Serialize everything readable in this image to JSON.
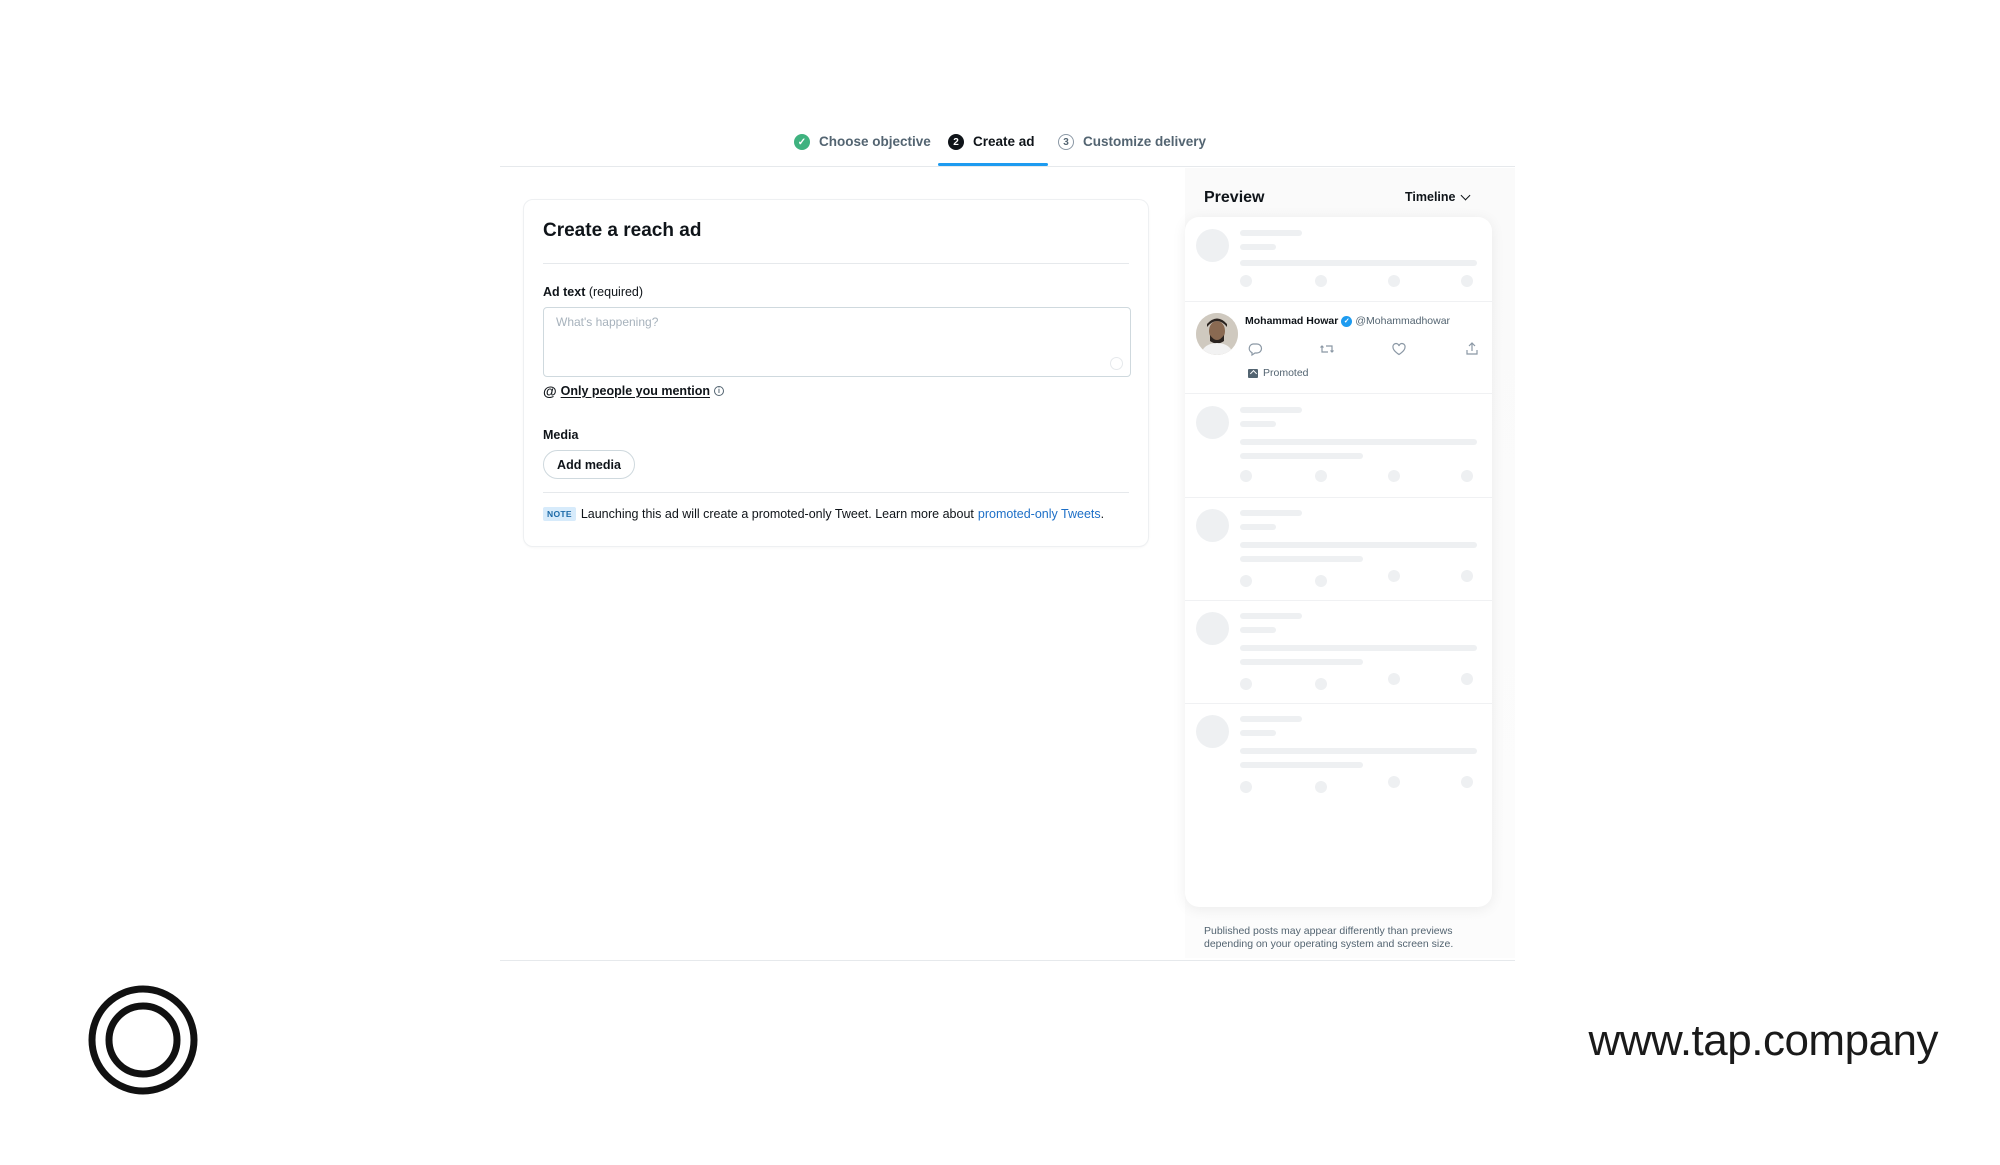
{
  "stepper": {
    "steps": [
      {
        "number": "✓",
        "label": "Choose objective",
        "state": "done"
      },
      {
        "number": "2",
        "label": "Create ad",
        "state": "active"
      },
      {
        "number": "3",
        "label": "Customize delivery",
        "state": "upcoming"
      }
    ]
  },
  "form": {
    "title": "Create a reach ad",
    "ad_text_label": "Ad text",
    "ad_text_required": "(required)",
    "ad_text_placeholder": "What's happening?",
    "ad_text_value": "",
    "mention_at": "@",
    "mention_setting": "Only people you mention",
    "media_label": "Media",
    "add_media_button": "Add media",
    "note_badge": "NOTE",
    "note_text": "Launching this ad will create a promoted-only Tweet. Learn more about",
    "note_link": "promoted-only Tweets",
    "note_end": "."
  },
  "preview": {
    "title": "Preview",
    "placement": "Timeline",
    "tweet": {
      "name": "Mohammad Howar",
      "handle": "@Mohammadhowar",
      "promoted_label": "Promoted"
    },
    "disclaimer": "Published posts may appear differently than previews depending on your operating system and screen size."
  },
  "branding": {
    "url": "www.tap.company"
  },
  "colors": {
    "accent": "#1d9bf0",
    "done": "#3fb27f",
    "link": "#1d6fc7"
  }
}
